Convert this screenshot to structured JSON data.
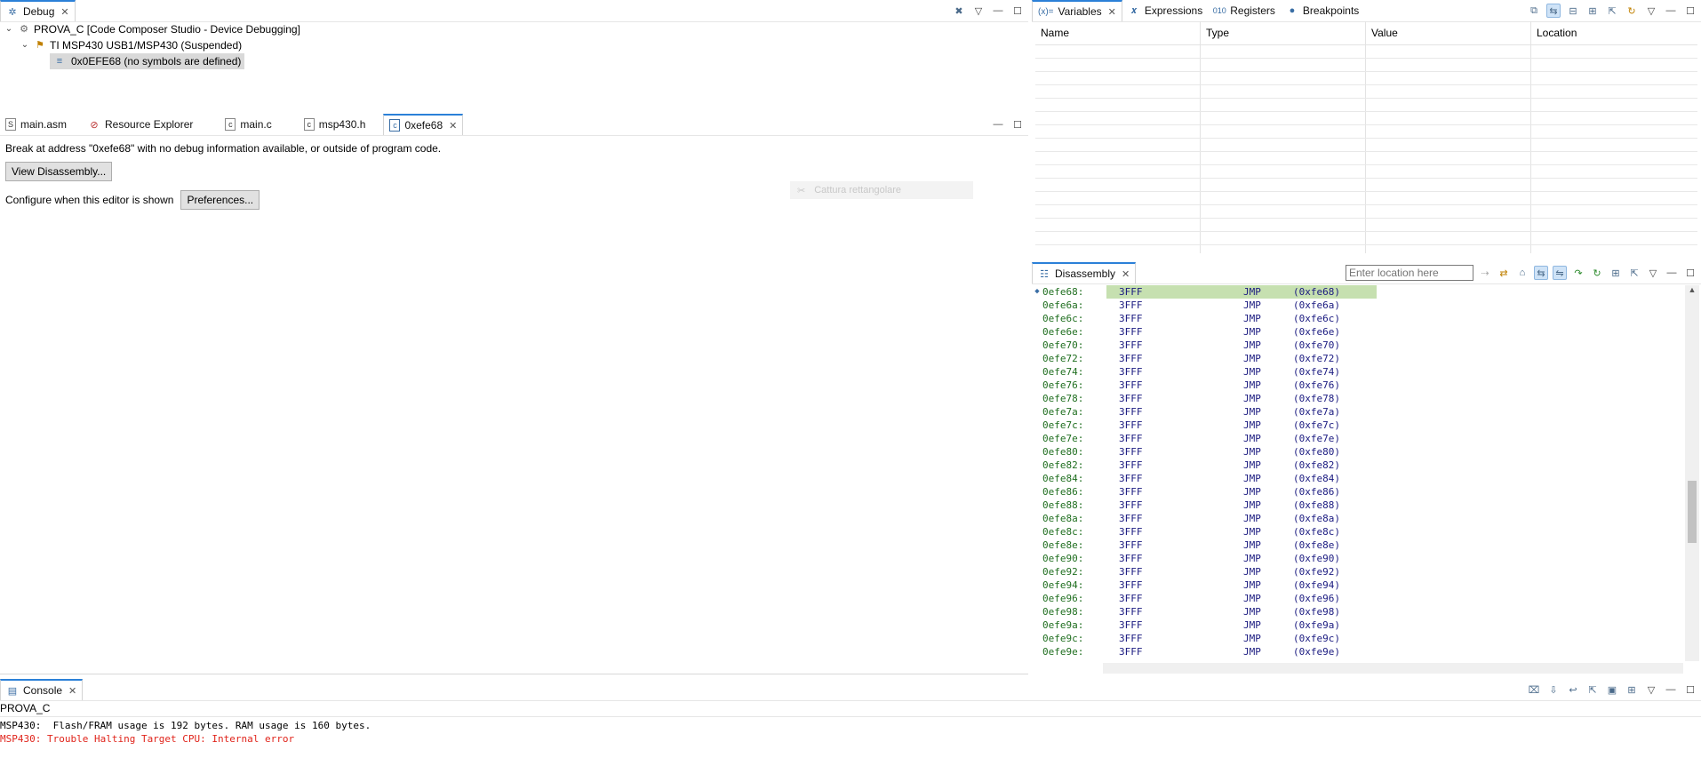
{
  "debug": {
    "tab_label": "Debug",
    "tree": [
      {
        "label": "PROVA_C [Code Composer Studio - Device Debugging]"
      },
      {
        "label": "TI MSP430 USB1/MSP430 (Suspended)"
      },
      {
        "label": "0x0EFE68  (no symbols are defined)"
      }
    ]
  },
  "variables": {
    "tabs": [
      "Variables",
      "Expressions",
      "Registers",
      "Breakpoints"
    ],
    "tab_prefix": "(x)=",
    "columns": [
      "Name",
      "Type",
      "Value",
      "Location"
    ]
  },
  "editor": {
    "tabs": [
      "main.asm",
      "Resource Explorer",
      "main.c",
      "msp430.h",
      "0xefe68"
    ],
    "message": "Break at address \"0xefe68\" with no debug information available, or outside of program code.",
    "view_disassembly": "View Disassembly...",
    "configure_text": "Configure when this editor is shown",
    "preferences": "Preferences..."
  },
  "overlay": {
    "text": "Cattura rettangolare"
  },
  "disassembly": {
    "tab_label": "Disassembly",
    "location_placeholder": "Enter location here",
    "rows": [
      {
        "addr": "0efe68:",
        "hex": "3FFF",
        "mn": "JMP",
        "op": "(0xfe68)"
      },
      {
        "addr": "0efe6a:",
        "hex": "3FFF",
        "mn": "JMP",
        "op": "(0xfe6a)"
      },
      {
        "addr": "0efe6c:",
        "hex": "3FFF",
        "mn": "JMP",
        "op": "(0xfe6c)"
      },
      {
        "addr": "0efe6e:",
        "hex": "3FFF",
        "mn": "JMP",
        "op": "(0xfe6e)"
      },
      {
        "addr": "0efe70:",
        "hex": "3FFF",
        "mn": "JMP",
        "op": "(0xfe70)"
      },
      {
        "addr": "0efe72:",
        "hex": "3FFF",
        "mn": "JMP",
        "op": "(0xfe72)"
      },
      {
        "addr": "0efe74:",
        "hex": "3FFF",
        "mn": "JMP",
        "op": "(0xfe74)"
      },
      {
        "addr": "0efe76:",
        "hex": "3FFF",
        "mn": "JMP",
        "op": "(0xfe76)"
      },
      {
        "addr": "0efe78:",
        "hex": "3FFF",
        "mn": "JMP",
        "op": "(0xfe78)"
      },
      {
        "addr": "0efe7a:",
        "hex": "3FFF",
        "mn": "JMP",
        "op": "(0xfe7a)"
      },
      {
        "addr": "0efe7c:",
        "hex": "3FFF",
        "mn": "JMP",
        "op": "(0xfe7c)"
      },
      {
        "addr": "0efe7e:",
        "hex": "3FFF",
        "mn": "JMP",
        "op": "(0xfe7e)"
      },
      {
        "addr": "0efe80:",
        "hex": "3FFF",
        "mn": "JMP",
        "op": "(0xfe80)"
      },
      {
        "addr": "0efe82:",
        "hex": "3FFF",
        "mn": "JMP",
        "op": "(0xfe82)"
      },
      {
        "addr": "0efe84:",
        "hex": "3FFF",
        "mn": "JMP",
        "op": "(0xfe84)"
      },
      {
        "addr": "0efe86:",
        "hex": "3FFF",
        "mn": "JMP",
        "op": "(0xfe86)"
      },
      {
        "addr": "0efe88:",
        "hex": "3FFF",
        "mn": "JMP",
        "op": "(0xfe88)"
      },
      {
        "addr": "0efe8a:",
        "hex": "3FFF",
        "mn": "JMP",
        "op": "(0xfe8a)"
      },
      {
        "addr": "0efe8c:",
        "hex": "3FFF",
        "mn": "JMP",
        "op": "(0xfe8c)"
      },
      {
        "addr": "0efe8e:",
        "hex": "3FFF",
        "mn": "JMP",
        "op": "(0xfe8e)"
      },
      {
        "addr": "0efe90:",
        "hex": "3FFF",
        "mn": "JMP",
        "op": "(0xfe90)"
      },
      {
        "addr": "0efe92:",
        "hex": "3FFF",
        "mn": "JMP",
        "op": "(0xfe92)"
      },
      {
        "addr": "0efe94:",
        "hex": "3FFF",
        "mn": "JMP",
        "op": "(0xfe94)"
      },
      {
        "addr": "0efe96:",
        "hex": "3FFF",
        "mn": "JMP",
        "op": "(0xfe96)"
      },
      {
        "addr": "0efe98:",
        "hex": "3FFF",
        "mn": "JMP",
        "op": "(0xfe98)"
      },
      {
        "addr": "0efe9a:",
        "hex": "3FFF",
        "mn": "JMP",
        "op": "(0xfe9a)"
      },
      {
        "addr": "0efe9c:",
        "hex": "3FFF",
        "mn": "JMP",
        "op": "(0xfe9c)"
      },
      {
        "addr": "0efe9e:",
        "hex": "3FFF",
        "mn": "JMP",
        "op": "(0xfe9e)"
      }
    ]
  },
  "console": {
    "tab_label": "Console",
    "project": "PROVA_C",
    "lines": [
      {
        "text": "MSP430:  Flash/FRAM usage is 192 bytes. RAM usage is 160 bytes.",
        "color": "#000000"
      },
      {
        "text": "MSP430: Trouble Halting Target CPU: Internal error",
        "color": "#e0241b"
      }
    ]
  },
  "colors": {
    "accent": "#2b80d8",
    "current_line": "#c6e0b0",
    "error": "#e0241b",
    "address": "#1f6e1f"
  }
}
